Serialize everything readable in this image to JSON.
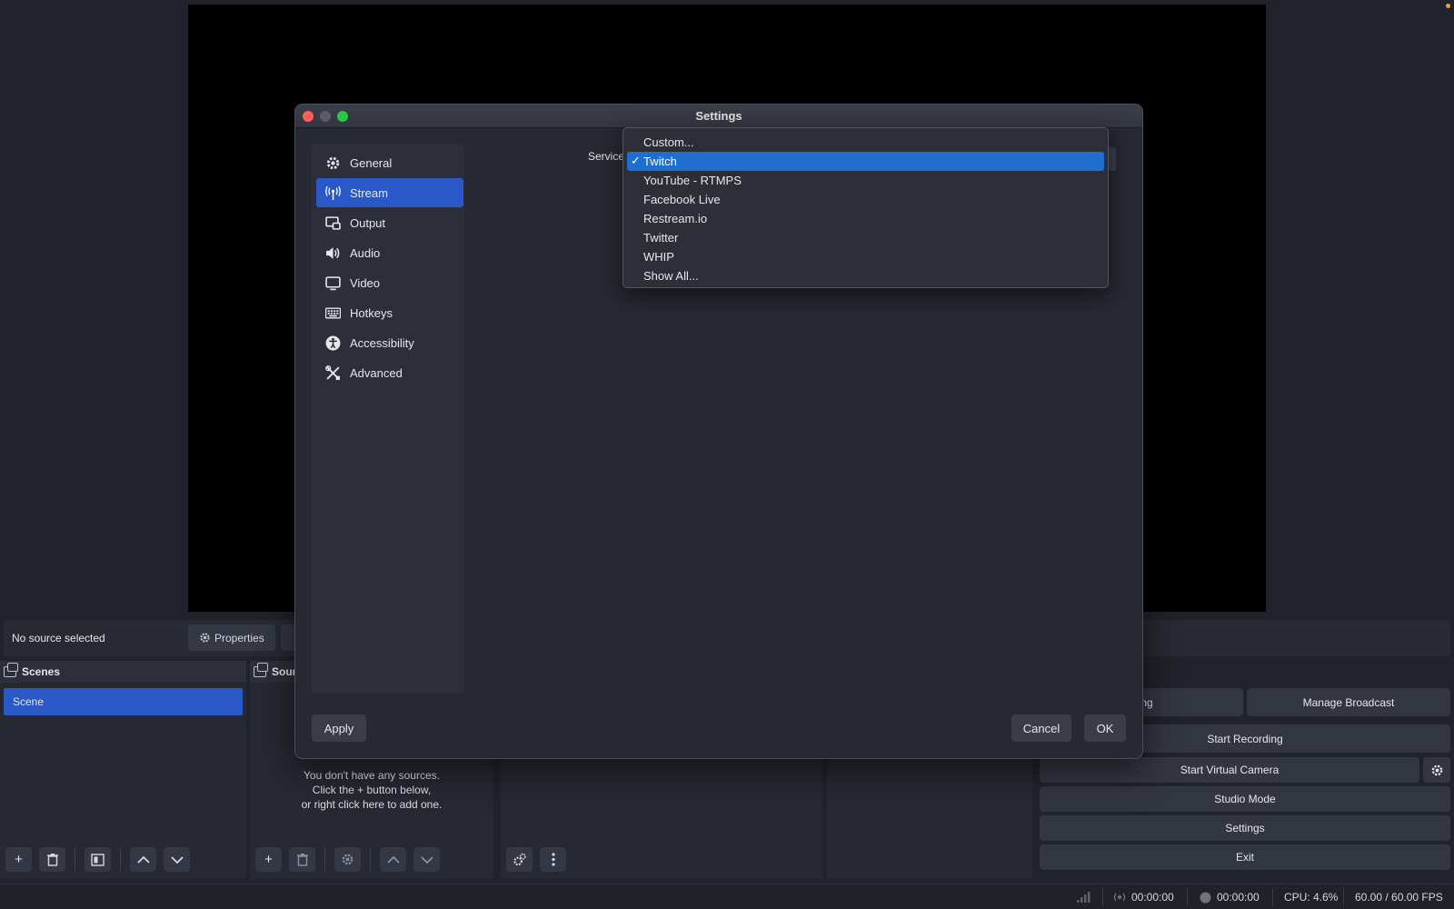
{
  "app": {
    "source_bar": {
      "no_source": "No source selected",
      "properties_label": "Properties"
    },
    "scenes": {
      "title": "Scenes",
      "items": [
        "Scene"
      ]
    },
    "sources": {
      "title": "Sour",
      "empty_lines": [
        "You don't have any sources.",
        "Click the + button below,",
        "or right click here to add one."
      ]
    },
    "controls": {
      "streaming_label": "eaming",
      "manage_broadcast": "Manage Broadcast",
      "start_recording": "Start Recording",
      "start_virtual_camera": "Start Virtual Camera",
      "studio_mode": "Studio Mode",
      "settings": "Settings",
      "exit": "Exit"
    },
    "status": {
      "stream_time": "00:00:00",
      "record_time": "00:00:00",
      "cpu": "CPU: 4.6%",
      "fps": "60.00 / 60.00 FPS"
    }
  },
  "dialog": {
    "title": "Settings",
    "nav": [
      {
        "label": "General",
        "icon": "gear-icon"
      },
      {
        "label": "Stream",
        "icon": "antenna-icon",
        "active": true
      },
      {
        "label": "Output",
        "icon": "output-icon"
      },
      {
        "label": "Audio",
        "icon": "speaker-icon"
      },
      {
        "label": "Video",
        "icon": "monitor-icon"
      },
      {
        "label": "Hotkeys",
        "icon": "keyboard-icon"
      },
      {
        "label": "Accessibility",
        "icon": "accessibility-icon"
      },
      {
        "label": "Advanced",
        "icon": "tools-icon"
      }
    ],
    "service_label": "Service",
    "apply": "Apply",
    "cancel": "Cancel",
    "ok": "OK",
    "colors": {
      "accent": "#2a58c9",
      "selection": "#1e6fd0"
    }
  },
  "service_dropdown": {
    "selected": "Twitch",
    "options": [
      "Custom...",
      "Twitch",
      "YouTube - RTMPS",
      "Facebook Live",
      "Restream.io",
      "Twitter",
      "WHIP",
      "Show All..."
    ]
  }
}
